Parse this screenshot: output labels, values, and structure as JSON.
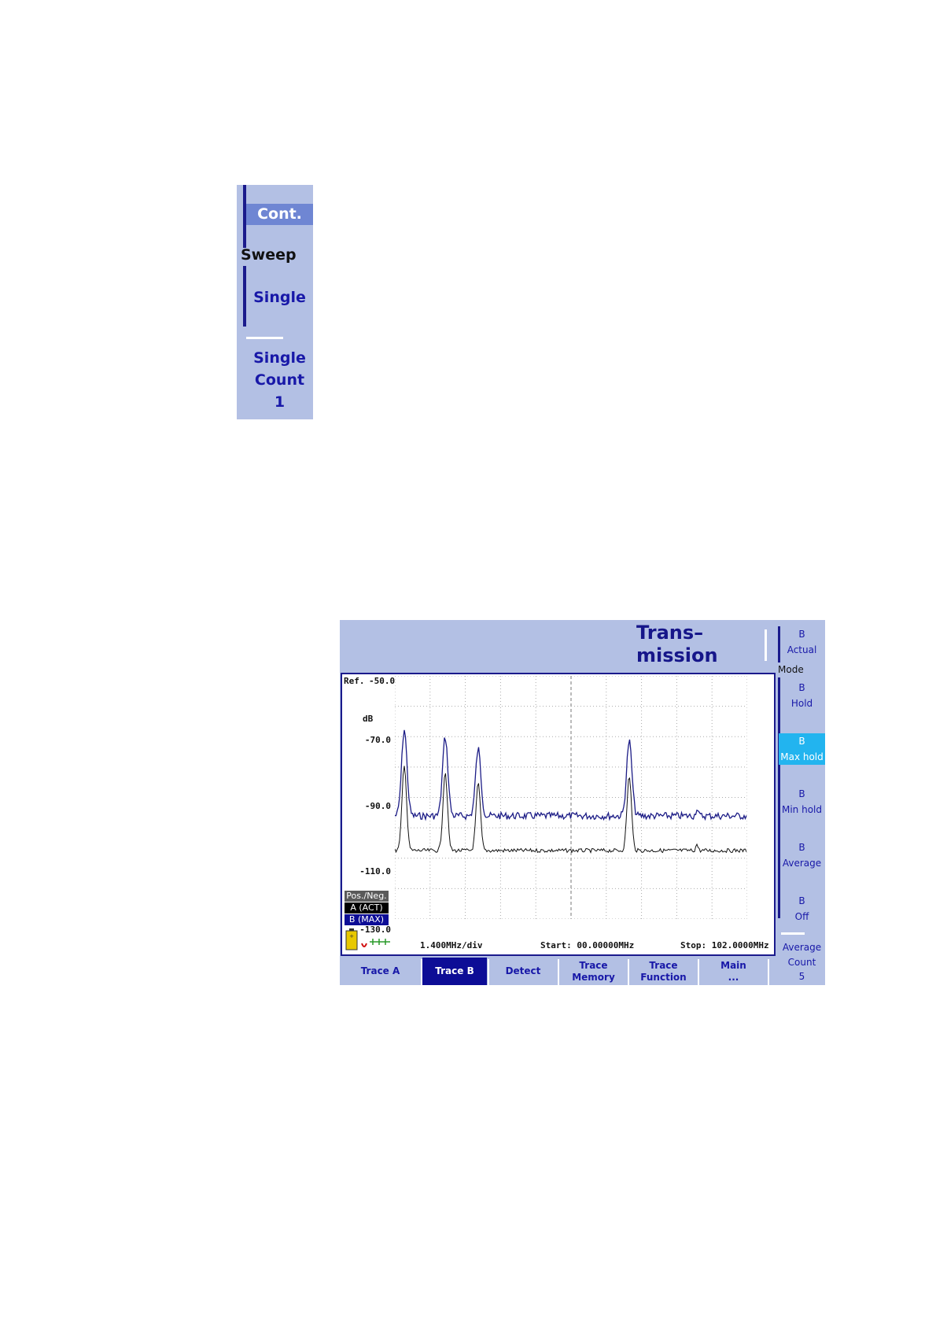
{
  "sweep_panel": {
    "cont_label": "Cont.",
    "group_label": "Sweep",
    "single_label": "Single",
    "single_count_line1": "Single",
    "single_count_line2": "Count",
    "single_count_value": "1"
  },
  "analyzer": {
    "title_line1": "Trans–",
    "title_line2": "mission",
    "graph": {
      "ref_label": "Ref.",
      "ref_value": "-50.0",
      "unit": "dB",
      "y_ticks": [
        "-70.0",
        "-90.0",
        "-110.0",
        "-130.0"
      ],
      "pos_neg_label": "Pos./Neg.",
      "trace_a_badge": "A (ACT)",
      "trace_b_badge": "B (MAX)",
      "scale_label": "1.400MHz/div",
      "start_label": "Start: 00.00000MHz",
      "stop_label": "Stop: 102.0000MHz"
    },
    "side_softkeys": {
      "actual_line1": "B",
      "actual_line2": "Actual",
      "mode_label": "Mode",
      "hold_line1": "B",
      "hold_line2": "Hold",
      "maxhold_line1": "B",
      "maxhold_line2": "Max hold",
      "minhold_line1": "B",
      "minhold_line2": "Min hold",
      "average_line1": "B",
      "average_line2": "Average",
      "off_line1": "B",
      "off_line2": "Off",
      "avgcount_line1": "Average",
      "avgcount_line2": "Count",
      "avgcount_value": "5"
    },
    "bottom_tabs": [
      {
        "line1": "Trace A",
        "line2": ""
      },
      {
        "line1": "Trace B",
        "line2": ""
      },
      {
        "line1": "Detect",
        "line2": ""
      },
      {
        "line1": "Trace",
        "line2": "Memory"
      },
      {
        "line1": "Trace",
        "line2": "Function"
      },
      {
        "line1": "Main",
        "line2": "..."
      }
    ],
    "colors": {
      "panel_bg": "#b3c0e4",
      "accent_dark": "#1a1a8c",
      "active_softkey": "#22b4ef",
      "active_tab": "#0d0d96",
      "trace_b": "#1c1c86",
      "trace_a": "#111111"
    }
  }
}
